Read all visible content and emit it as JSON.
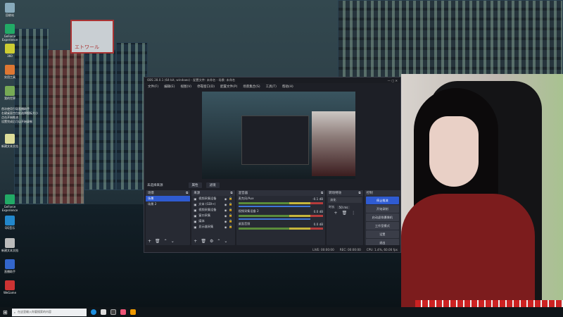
{
  "desktop": {
    "icons": [
      {
        "label": "回收站"
      },
      {
        "label": "GeForce Experience"
      },
      {
        "label": "360"
      },
      {
        "label": "实用工具"
      },
      {
        "label": "我的世界"
      },
      {
        "label": "新建文本文档"
      },
      {
        "label": "GeForce Experience"
      },
      {
        "label": "QQ音乐"
      },
      {
        "label": "新建文本文档"
      },
      {
        "label": "直播助手"
      },
      {
        "label": "WeGame"
      }
    ],
    "notes": [
      "首次使用引导直播助手",
      "右键桌面空白处选择图标大小",
      "点击开始推流",
      "设置完成后可以开始录制"
    ],
    "sign_text": "エトワール"
  },
  "obs": {
    "title": "OBS 28.0.1 (64-bit, windows) - 配置文件: 未命名 - 场景: 未命名",
    "menu": [
      "文件(F)",
      "编辑(E)",
      "视图(V)",
      "停靠窗口(D)",
      "配置文件(P)",
      "场景集合(S)",
      "工具(T)",
      "帮助(H)"
    ],
    "source_bar": {
      "label": "未选择来源",
      "properties": "属性",
      "filters": "滤镜"
    },
    "scenes": {
      "title": "场景",
      "items": [
        "场景",
        "场景 2"
      ]
    },
    "sources": {
      "title": "来源",
      "items": [
        "视频采集设备",
        "文本 (GDI+)",
        "视频采集设备",
        "窗口采集",
        "媒体",
        "显示器采集"
      ]
    },
    "mixer": {
      "title": "混音器",
      "channels": [
        {
          "name": "麦克风/Aux",
          "db": "-0.1 dB",
          "level": 0.95
        },
        {
          "name": "视频采集设备 2",
          "db": "0.0 dB",
          "level": 0.95
        },
        {
          "name": "桌面音频",
          "db": "0.0 dB",
          "level": 0
        }
      ]
    },
    "transitions": {
      "title": "转场特效",
      "type": "淡化",
      "duration_label": "时长",
      "duration": "50 ms"
    },
    "controls": {
      "title": "控制",
      "buttons": [
        "停止推流",
        "开始录制",
        "启动虚拟摄像机",
        "工作室模式",
        "设置",
        "退出"
      ]
    },
    "status": {
      "live": "LIVE: 00:00:00",
      "rec": "REC: 00:00:00",
      "cpu": "CPU: 1.4%, 60.00 fps"
    }
  },
  "taskbar": {
    "search_placeholder": "在这里输入你要搜索的内容"
  }
}
